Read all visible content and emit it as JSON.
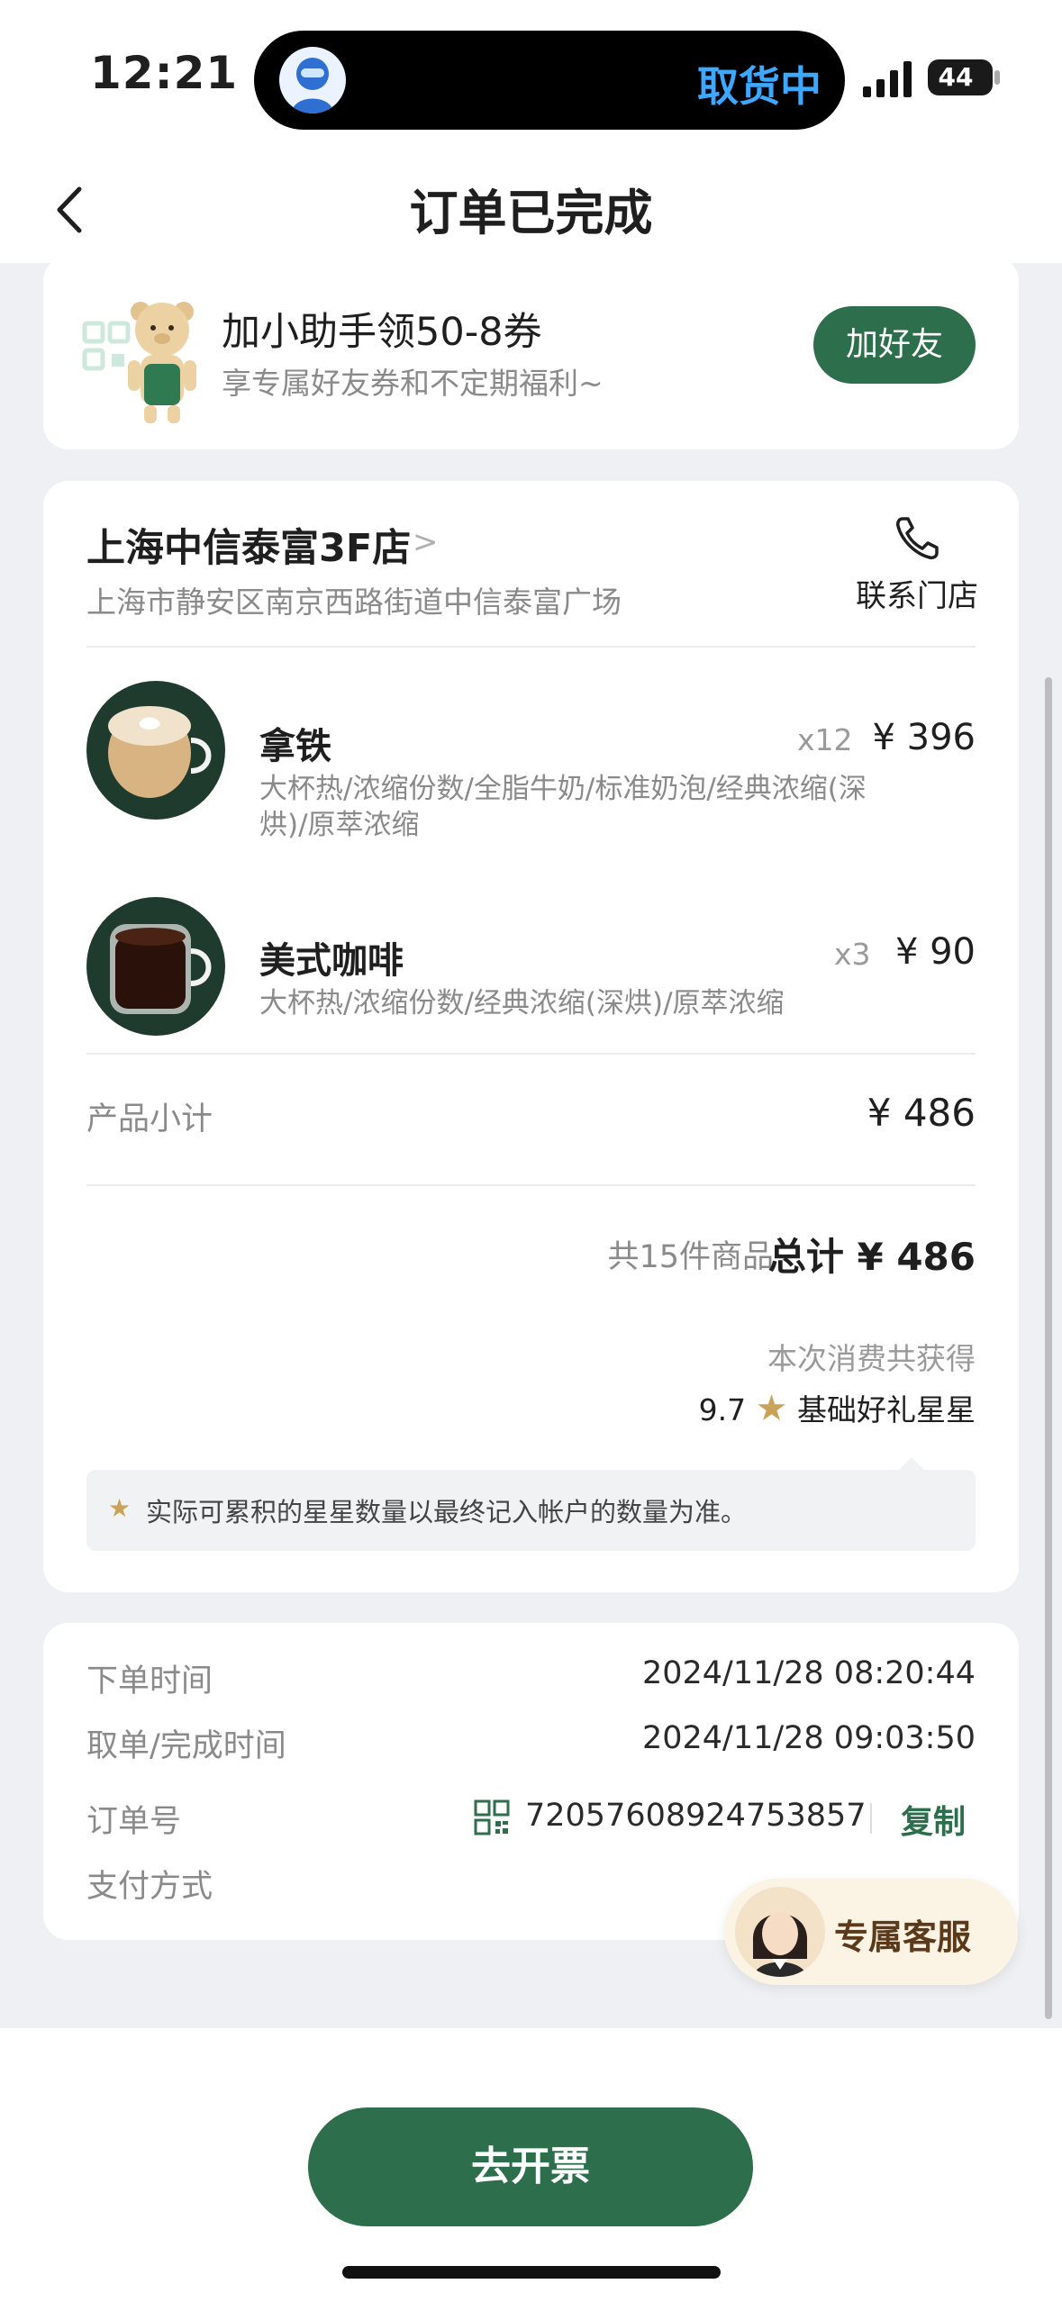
{
  "status_bar": {
    "time": "12:21",
    "live_activity_text": "取货中",
    "battery": "44"
  },
  "nav": {
    "title": "订单已完成"
  },
  "helper_card": {
    "title": "加小助手领50-8券",
    "subtitle": "享专属好友券和不定期福利~",
    "button_label": "加好友"
  },
  "store": {
    "name": "上海中信泰富3F店",
    "address": "上海市静安区南京西路街道中信泰富广场",
    "contact_label": "联系门店"
  },
  "items": [
    {
      "name": "拿铁",
      "qty": "x12",
      "price": "¥ 396",
      "desc_line1": "大杯热/浓缩份数/全脂牛奶/标准奶泡/经典浓缩(深",
      "desc_line2": "烘)/原萃浓缩"
    },
    {
      "name": "美式咖啡",
      "qty": "x3",
      "price": "¥ 90",
      "desc_line1": "大杯热/浓缩份数/经典浓缩(深烘)/原萃浓缩"
    }
  ],
  "summary": {
    "subtotal_label": "产品小计",
    "subtotal_value": "¥ 486",
    "count_text": "共15件商品",
    "total_text": "总计 ¥ 486",
    "earn_caption": "本次消费共获得",
    "stars_value": "9.7",
    "stars_label": "基础好礼星星",
    "notice": "实际可累积的星星数量以最终记入帐户的数量为准。"
  },
  "info": {
    "order_time_label": "下单时间",
    "order_time": "2024/11/28 08:20:44",
    "complete_time_label": "取单/完成时间",
    "complete_time": "2024/11/28 09:03:50",
    "order_no_label": "订单号",
    "order_no": "72057608924753857",
    "copy_label": "复制",
    "payment_label": "支付方式"
  },
  "service": {
    "label": "专属客服"
  },
  "bottom": {
    "invoice_label": "去开票"
  },
  "colors": {
    "brand_green": "#2d6e4c",
    "star_gold": "#c9a458",
    "island_text_blue": "#3ea8ff"
  }
}
